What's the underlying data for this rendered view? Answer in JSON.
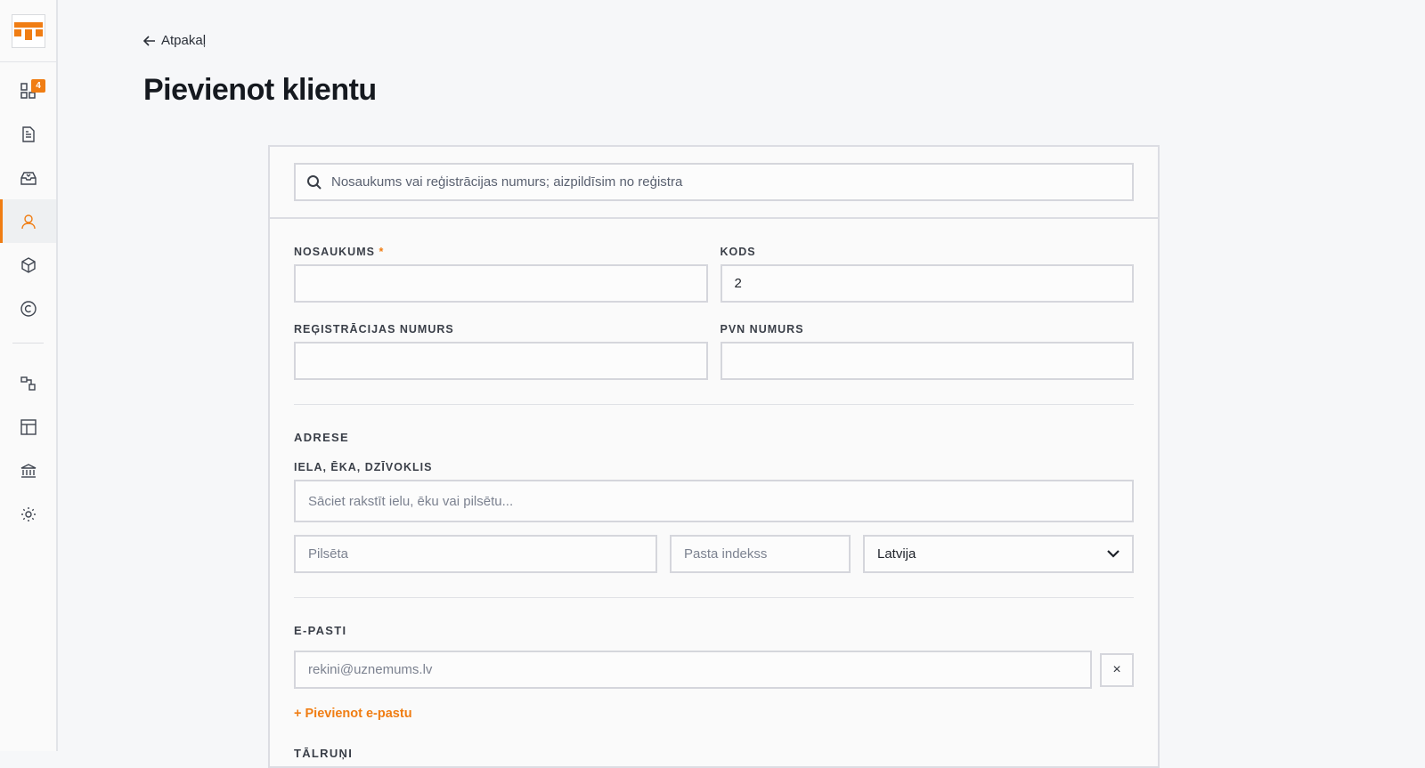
{
  "sidebar": {
    "badge_count": "4",
    "accent_color": "#f07d13",
    "items": [
      {
        "name": "dashboard-icon"
      },
      {
        "name": "document-icon"
      },
      {
        "name": "inbox-icon"
      },
      {
        "name": "user-icon",
        "active": true
      },
      {
        "name": "box-icon"
      },
      {
        "name": "copyright-icon"
      },
      {
        "name": "shapes-icon"
      },
      {
        "name": "layout-icon"
      },
      {
        "name": "bank-icon"
      },
      {
        "name": "gear-icon"
      }
    ]
  },
  "header": {
    "back_label": "Atpakaļ",
    "title": "Pievienot klientu"
  },
  "search": {
    "placeholder": "Nosaukums vai reģistrācijas numurs; aizpildīsim no reģistra"
  },
  "fields": {
    "name_label": "NOSAUKUMS",
    "name_required_mark": "*",
    "name_value": "",
    "code_label": "KODS",
    "code_value": "2",
    "reg_label": "REĢISTRĀCIJAS NUMURS",
    "reg_value": "",
    "vat_label": "PVN NUMURS",
    "vat_value": ""
  },
  "address": {
    "section_title": "ADRESE",
    "street_label": "IELA, ĒKA, DZĪVOKLIS",
    "street_placeholder": "Sāciet rakstīt ielu, ēku vai pilsētu...",
    "city_placeholder": "Pilsēta",
    "zip_placeholder": "Pasta indekss",
    "country_value": "Latvija"
  },
  "emails": {
    "section_title": "E-PASTI",
    "email_placeholder": "rekini@uznemums.lv",
    "remove_label": "×",
    "add_label": "+ Pievienot e-pastu"
  },
  "phones": {
    "section_title": "TĀLRUŅI"
  }
}
